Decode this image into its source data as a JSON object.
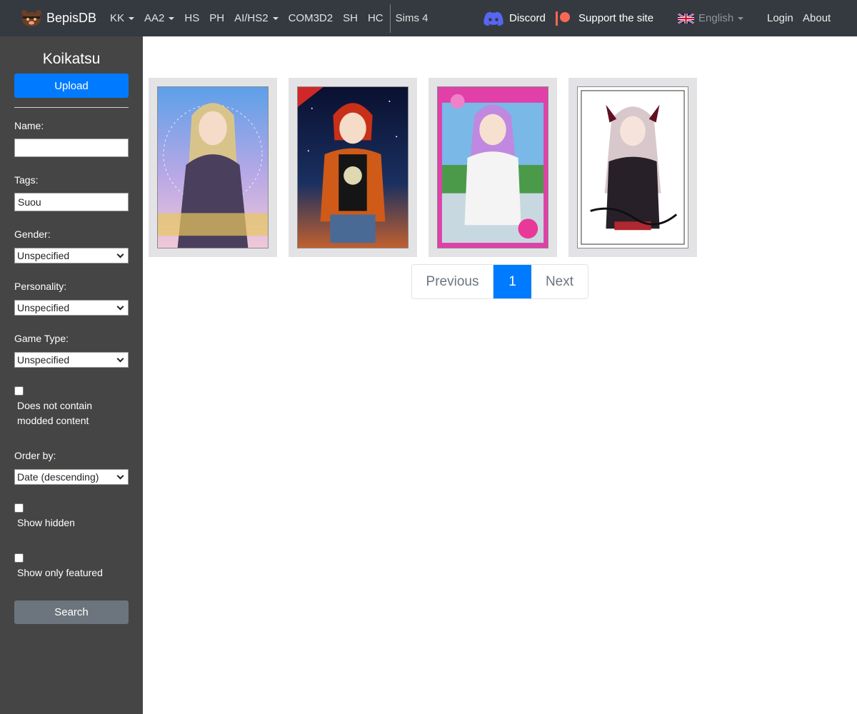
{
  "navbar": {
    "brand": "BepisDB",
    "links": [
      {
        "label": "KK",
        "dropdown": true
      },
      {
        "label": "AA2",
        "dropdown": true
      },
      {
        "label": "HS",
        "dropdown": false
      },
      {
        "label": "PH",
        "dropdown": false
      },
      {
        "label": "AI/HS2",
        "dropdown": true
      },
      {
        "label": "COM3D2",
        "dropdown": false
      },
      {
        "label": "SH",
        "dropdown": false
      },
      {
        "label": "HC",
        "dropdown": false
      },
      {
        "label": "Sims 4",
        "dropdown": false
      }
    ],
    "discord": "Discord",
    "support": "Support the site",
    "language": "English",
    "login": "Login",
    "about": "About"
  },
  "sidebar": {
    "title": "Koikatsu",
    "upload_label": "Upload",
    "name_label": "Name:",
    "name_value": "",
    "tags_label": "Tags:",
    "tags_value": "Suou",
    "gender_label": "Gender:",
    "gender_value": "Unspecified",
    "personality_label": "Personality:",
    "personality_value": "Unspecified",
    "game_type_label": "Game Type:",
    "game_type_value": "Unspecified",
    "no_modded_label": "Does not contain modded content",
    "order_label": "Order by:",
    "order_value": "Date (descending)",
    "show_hidden_label": "Show hidden",
    "show_featured_label": "Show only featured",
    "search_label": "Search"
  },
  "cards": [
    {
      "alt": "character card 1"
    },
    {
      "alt": "character card 2"
    },
    {
      "alt": "character card 3"
    },
    {
      "alt": "character card 4"
    }
  ],
  "pagination": {
    "previous": "Previous",
    "current": "1",
    "next": "Next"
  },
  "colors": {
    "navbar_bg": "#343a40",
    "sidebar_bg": "#454545",
    "primary": "#007bff",
    "secondary": "#6c757d",
    "card_bg": "#e3e3e6"
  }
}
